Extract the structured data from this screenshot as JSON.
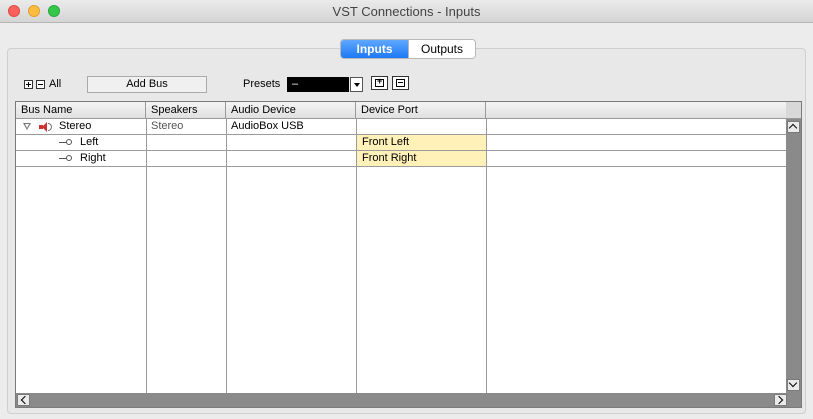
{
  "window": {
    "title": "VST Connections - Inputs"
  },
  "tabs": [
    {
      "label": "Inputs",
      "selected": true
    },
    {
      "label": "Outputs",
      "selected": false
    }
  ],
  "toolbar": {
    "all_label": "All",
    "add_bus_label": "Add Bus",
    "presets_label": "Presets",
    "presets_value": "–"
  },
  "table": {
    "columns": [
      "Bus Name",
      "Speakers",
      "Audio Device",
      "Device Port"
    ],
    "rows": [
      {
        "bus_name": "Stereo",
        "speakers": "Stereo",
        "audio_device": "AudioBox USB",
        "device_port": ""
      },
      {
        "bus_name": "Left",
        "speakers": "",
        "audio_device": "",
        "device_port": "Front Left"
      },
      {
        "bus_name": "Right",
        "speakers": "",
        "audio_device": "",
        "device_port": "Front Right"
      }
    ]
  },
  "colors": {
    "tab_selected": "#1d78f4",
    "port_highlight": "#fff1b8",
    "speaker_icon": "#cc3333"
  },
  "icons": [
    "expand-all-icon",
    "collapse-all-icon",
    "disclosure-triangle-icon",
    "speaker-icon",
    "channel-connector-icon",
    "store-preset-icon",
    "remove-preset-icon"
  ]
}
